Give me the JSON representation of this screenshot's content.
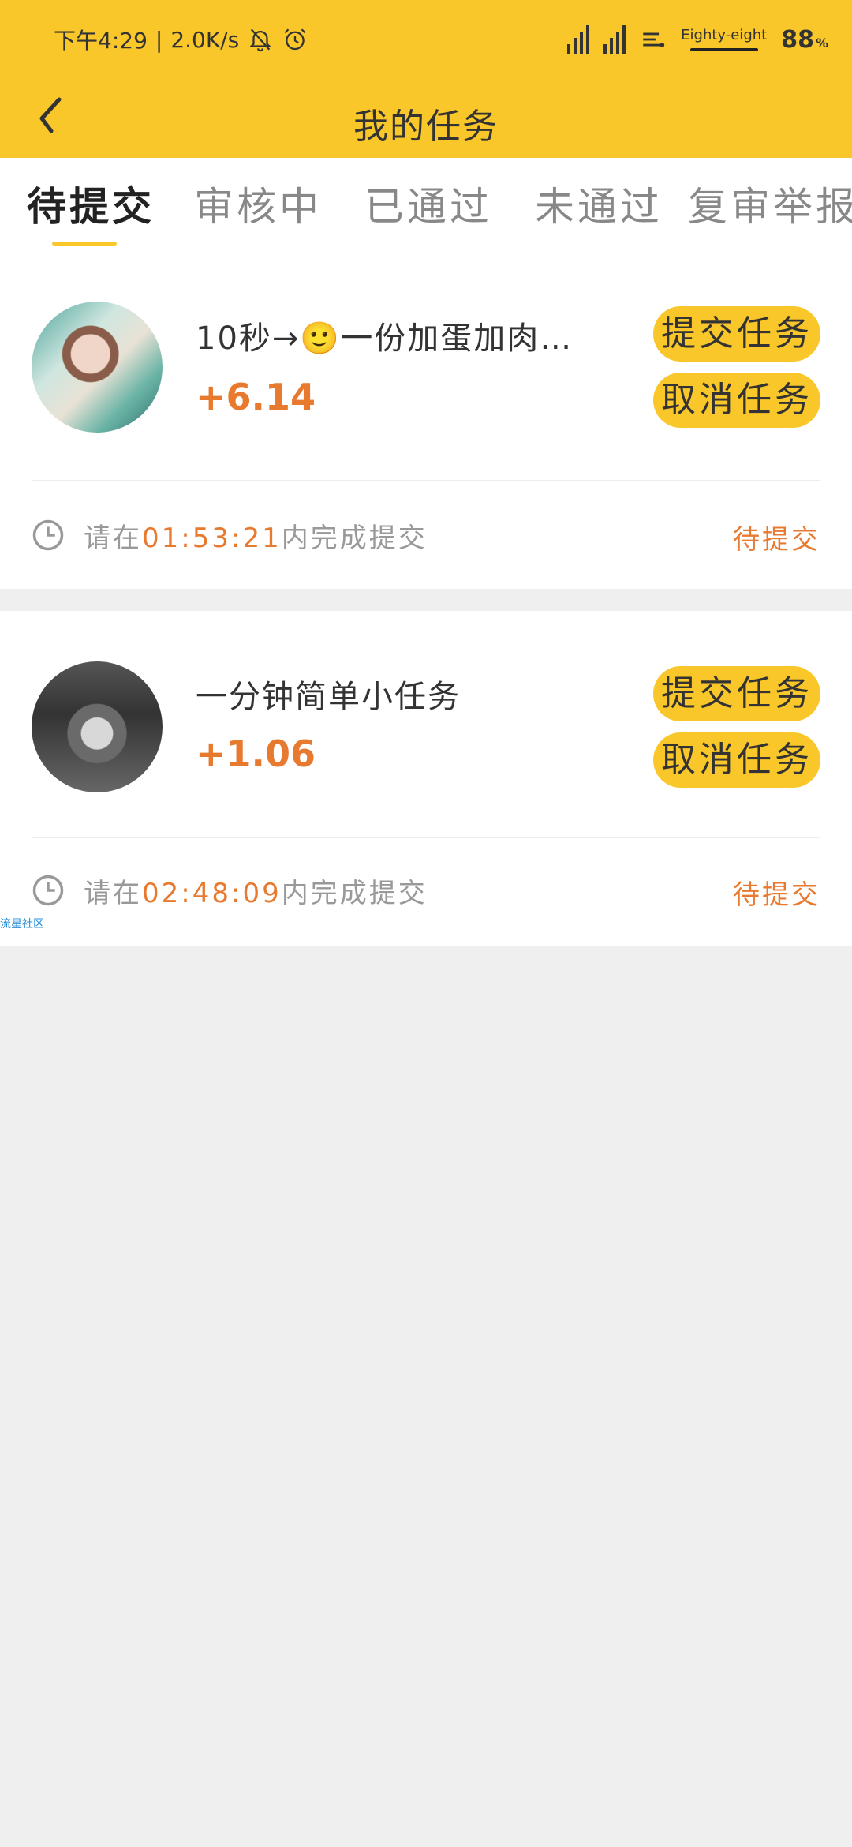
{
  "status_bar": {
    "time": "下午4:29",
    "net_speed": "2.0K/s",
    "carrier": "Eighty-eight",
    "battery": "88",
    "battery_unit": "%"
  },
  "header": {
    "title": "我的任务"
  },
  "tabs": [
    {
      "label": "待提交",
      "active": true
    },
    {
      "label": "审核中",
      "active": false
    },
    {
      "label": "已通过",
      "active": false
    },
    {
      "label": "未通过",
      "active": false
    },
    {
      "label": "复审举报",
      "active": false
    }
  ],
  "tasks": [
    {
      "title": "10秒→🙂一份加蛋加肉…",
      "reward": "+6.14",
      "submit_label": "提交任务",
      "cancel_label": "取消任务",
      "deadline_prefix": "请在",
      "deadline_time": "01:53:21",
      "deadline_suffix": "内完成提交",
      "status": "待提交"
    },
    {
      "title": "一分钟简单小任务",
      "reward": "+1.06",
      "submit_label": "提交任务",
      "cancel_label": "取消任务",
      "deadline_prefix": "请在",
      "deadline_time": "02:48:09",
      "deadline_suffix": "内完成提交",
      "status": "待提交"
    }
  ],
  "watermark": "流星社区",
  "colors": {
    "accent": "#f9c72a",
    "reward": "#e87a30",
    "background": "#efefef"
  }
}
